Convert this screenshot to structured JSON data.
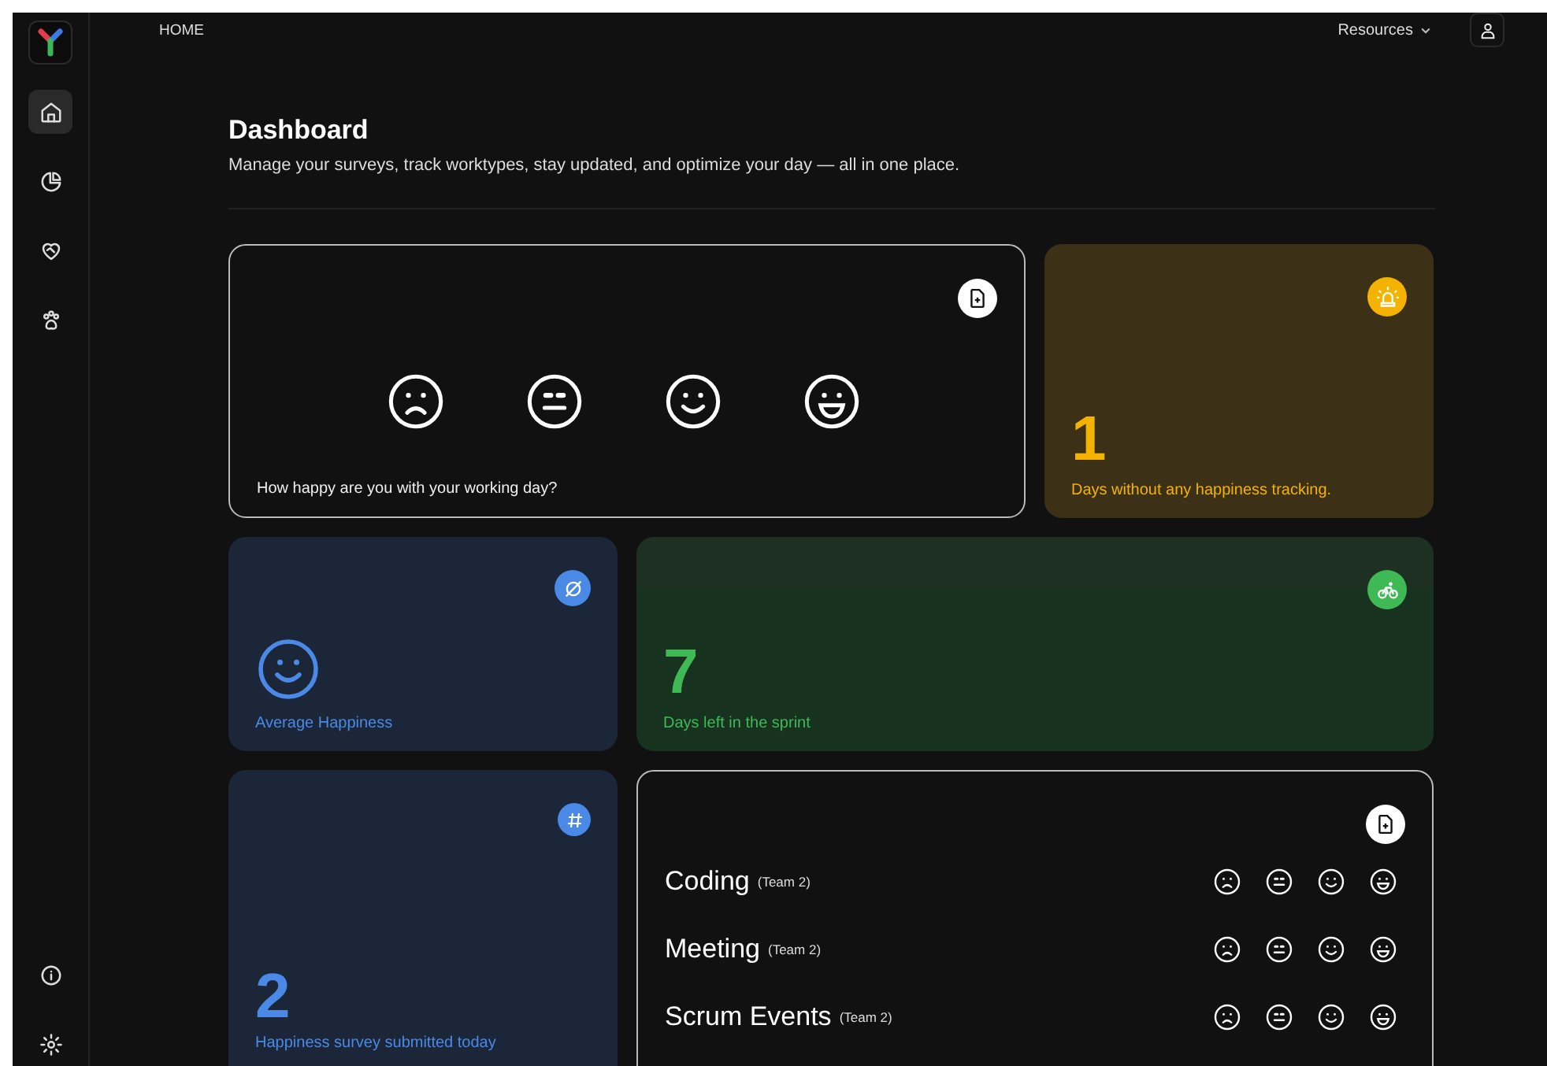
{
  "nav": [
    {
      "kind": "home",
      "selected": true
    },
    {
      "kind": "chart",
      "selected": false
    },
    {
      "kind": "heart",
      "selected": false
    },
    {
      "kind": "paw",
      "selected": false
    }
  ],
  "nav_bottom": [
    {
      "kind": "info"
    },
    {
      "kind": "gear"
    }
  ],
  "header": {
    "breadcrumb": "HOME",
    "menu": "Resources"
  },
  "page": {
    "title": "Dashboard",
    "subtitle": "Manage your surveys, track worktypes, stay updated, and optimize your day — all in one place."
  },
  "happiness_card": {
    "question": "How happy are you with your working day?",
    "faces": [
      {
        "kind": "sad"
      },
      {
        "kind": "neutral"
      },
      {
        "kind": "smile"
      },
      {
        "kind": "grin"
      }
    ]
  },
  "untracked_card": {
    "value": "1",
    "label": "Days without any happiness tracking."
  },
  "average_card": {
    "kind": "smile",
    "label": "Average Happiness"
  },
  "sprint_card": {
    "value": "7",
    "label": "Days left in the sprint"
  },
  "submitted_card": {
    "value": "2",
    "label": "Happiness survey submitted today"
  },
  "worktypes": [
    {
      "name": "Coding",
      "team": "(Team 2)",
      "faces": [
        {
          "kind": "sad"
        },
        {
          "kind": "neutral"
        },
        {
          "kind": "smile"
        },
        {
          "kind": "grin"
        }
      ]
    },
    {
      "name": "Meeting",
      "team": "(Team 2)",
      "faces": [
        {
          "kind": "sad"
        },
        {
          "kind": "neutral"
        },
        {
          "kind": "smile"
        },
        {
          "kind": "grin"
        }
      ]
    },
    {
      "name": "Scrum Events",
      "team": "(Team 2)",
      "faces": [
        {
          "kind": "sad"
        },
        {
          "kind": "neutral"
        },
        {
          "kind": "smile"
        },
        {
          "kind": "grin"
        }
      ]
    }
  ]
}
